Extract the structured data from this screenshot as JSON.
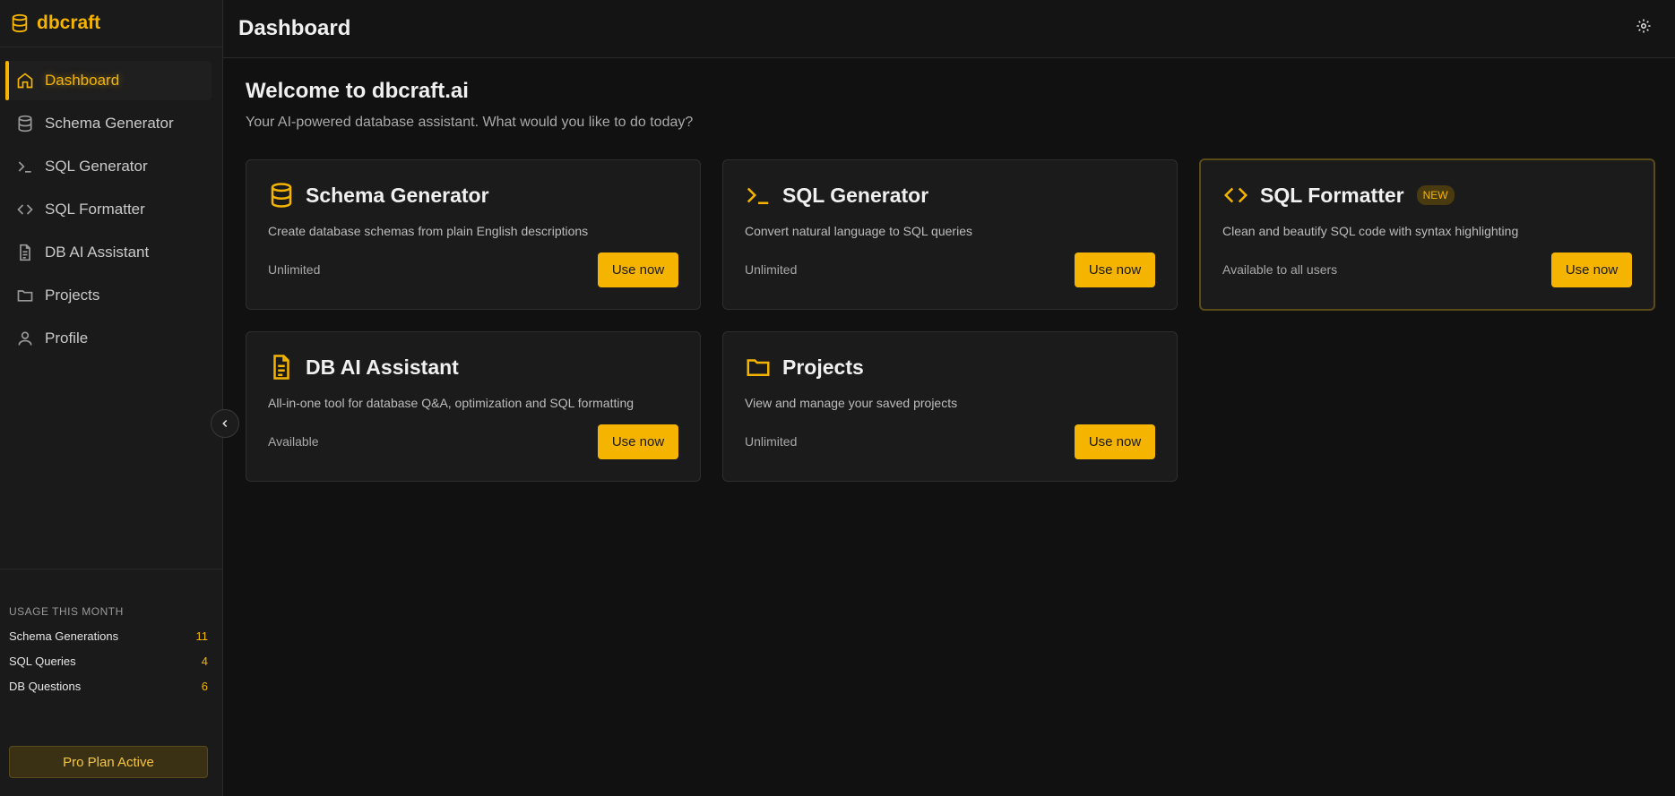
{
  "app": {
    "name": "dbcraft"
  },
  "sidebar": {
    "items": [
      {
        "label": "Dashboard",
        "icon": "home-icon"
      },
      {
        "label": "Schema Generator",
        "icon": "database-icon"
      },
      {
        "label": "SQL Generator",
        "icon": "terminal-icon"
      },
      {
        "label": "SQL Formatter",
        "icon": "code-icon"
      },
      {
        "label": "DB AI Assistant",
        "icon": "file-text-icon"
      },
      {
        "label": "Projects",
        "icon": "folder-icon"
      },
      {
        "label": "Profile",
        "icon": "user-icon"
      }
    ],
    "usage": {
      "title": "USAGE THIS MONTH",
      "rows": [
        {
          "label": "Schema Generations",
          "value": "11"
        },
        {
          "label": "SQL Queries",
          "value": "4"
        },
        {
          "label": "DB Questions",
          "value": "6"
        }
      ]
    },
    "plan": "Pro Plan Active"
  },
  "header": {
    "title": "Dashboard"
  },
  "main": {
    "welcome": "Welcome to dbcraft.ai",
    "subtitle": "Your AI-powered database assistant. What would you like to do today?",
    "cards": [
      {
        "title": "Schema Generator",
        "icon": "database-icon",
        "description": "Create database schemas from plain English descriptions",
        "status": "Unlimited",
        "button": "Use now"
      },
      {
        "title": "SQL Generator",
        "icon": "terminal-icon",
        "description": "Convert natural language to SQL queries",
        "status": "Unlimited",
        "button": "Use now"
      },
      {
        "title": "SQL Formatter",
        "icon": "code-icon",
        "badge": "NEW",
        "description": "Clean and beautify SQL code with syntax highlighting",
        "status": "Available to all users",
        "button": "Use now"
      },
      {
        "title": "DB AI Assistant",
        "icon": "file-text-icon",
        "description": "All-in-one tool for database Q&A, optimization and SQL formatting",
        "status": "Available",
        "button": "Use now"
      },
      {
        "title": "Projects",
        "icon": "folder-icon",
        "description": "View and manage your saved projects",
        "status": "Unlimited",
        "button": "Use now"
      }
    ]
  },
  "colors": {
    "accent": "#f5b400",
    "background": "#111111",
    "sidebar": "#1a1a1a",
    "card": "#1b1b1b"
  }
}
